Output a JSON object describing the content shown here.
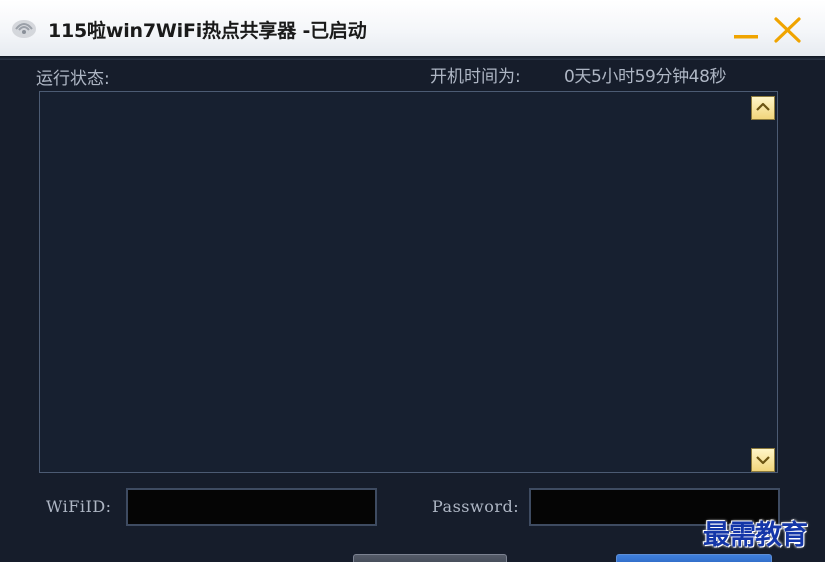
{
  "window": {
    "title": "115啦win7WiFi热点共享器 -已启动"
  },
  "status": {
    "label": "运行状态:",
    "uptime_label": "开机时间为:",
    "uptime_value": "0天5小时59分钟48秒"
  },
  "log": {
    "lines": []
  },
  "form": {
    "wifiid_label": "WiFiID:",
    "wifiid_value": "",
    "password_label": "Password:",
    "password_value": ""
  },
  "watermark": "最需教育",
  "icons": {
    "app": "wifi-app-icon",
    "minimize": "minimize-icon",
    "close": "close-icon",
    "scroll_up": "chevron-up-icon",
    "scroll_down": "chevron-down-icon"
  },
  "colors": {
    "window_bg": "#161d2b",
    "accent_gold": "#f0a400",
    "panel_border": "#4c5b73",
    "field_bg": "#050505",
    "watermark": "#1436a8"
  }
}
